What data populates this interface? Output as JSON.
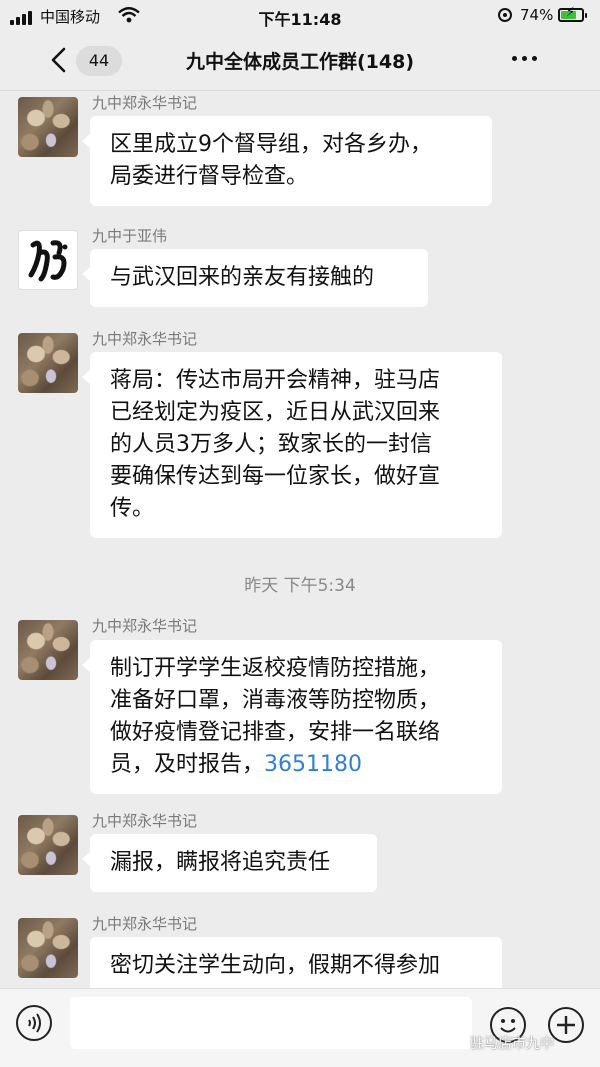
{
  "status_bar": {
    "carrier": "中国移动",
    "time": "下午11:48",
    "battery_percent": "74%",
    "battery_level": 0.74,
    "battery_color": "#3fbf3f"
  },
  "header": {
    "unread_count": "44",
    "title": "九中全体成员工作群(148)"
  },
  "messages": [
    {
      "sender": "九中郑永华书记",
      "text": "区里成立9个督导组，对各乡办，\n局委进行督导检查。",
      "avatar": "photo"
    },
    {
      "sender": "九中于亚伟",
      "text": "与武汉回来的亲友有接触的",
      "avatar": "calligraphy"
    },
    {
      "sender": "九中郑永华书记",
      "text": "蒋局：传达市局开会精神，驻马店\n已经划定为疫区，近日从武汉回来\n的人员3万多人；致家长的一封信\n要确保传达到每一位家长，做好宣\n传。",
      "avatar": "photo"
    },
    {
      "sender": "九中郑永华书记",
      "text": "制订开学学生返校疫情防控措施，\n准备好口罩，消毒液等防控物质，\n做好疫情登记排查，安排一名联络\n员，及时报告，",
      "link": "3651180",
      "avatar": "photo"
    },
    {
      "sender": "九中郑永华书记",
      "text": "漏报，瞒报将追究责任",
      "avatar": "photo"
    },
    {
      "sender": "九中郑永华书记",
      "text": "密切关注学生动向，假期不得参加",
      "avatar": "photo"
    }
  ],
  "timestamp": "昨天 下午5:34",
  "watermark": "驻马店市九中",
  "colors": {
    "link": "#2f7fd6",
    "background": "#ececec",
    "bubble": "#ffffff"
  }
}
